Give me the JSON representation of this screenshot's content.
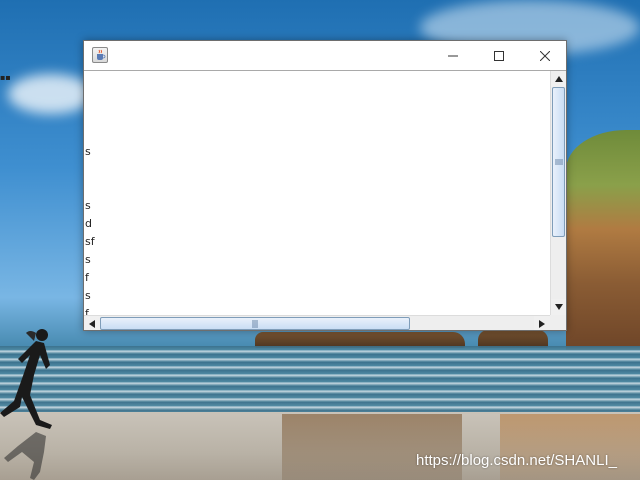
{
  "desktop": {
    "watermark": "https://blog.csdn.net/SHANLI_"
  },
  "window": {
    "title": "",
    "icon": "java-cup-icon",
    "controls": [
      "minimize-icon",
      "maximize-icon",
      "close-icon"
    ]
  },
  "textarea": {
    "lines": [
      "",
      "",
      "",
      "",
      "s",
      "",
      "",
      "s",
      "d",
      "sf",
      "s",
      "f",
      "s",
      "f"
    ]
  },
  "scrollbars": {
    "vertical_position": 0.0,
    "horizontal_position": 0.0
  }
}
